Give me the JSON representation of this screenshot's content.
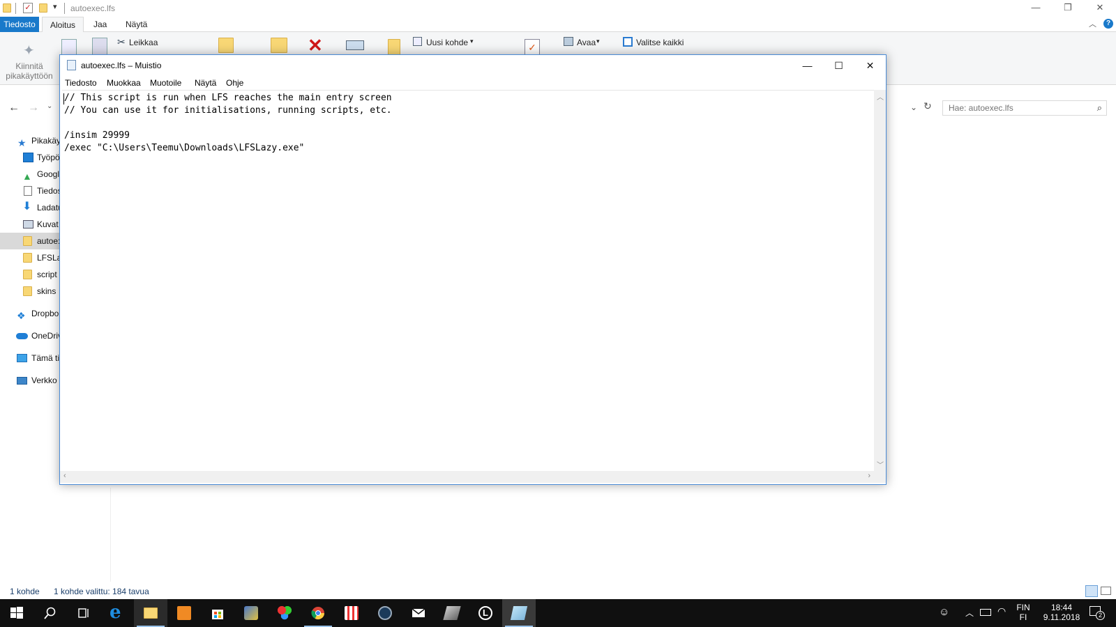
{
  "explorer": {
    "title": "autoexec.lfs",
    "tabs": [
      "Tiedosto",
      "Aloitus",
      "Jaa",
      "Näytä"
    ],
    "ribbon": {
      "pin_label_1": "Kiinnitä",
      "pin_label_2": "pikakäyttöön",
      "cut": "Leikkaa",
      "new_item": "Uusi kohde",
      "open": "Avaa",
      "select_all": "Valitse kaikki"
    },
    "search_placeholder": "Hae: autoexec.lfs",
    "nav": [
      {
        "label": "Pikakäy",
        "icon": "star-icon"
      },
      {
        "label": "Työpö",
        "icon": "desktop-icon"
      },
      {
        "label": "Googl",
        "icon": "google-drive-icon"
      },
      {
        "label": "Tiedos",
        "icon": "document-icon"
      },
      {
        "label": "Ladatu",
        "icon": "download-icon"
      },
      {
        "label": "Kuvat",
        "icon": "pictures-icon"
      },
      {
        "label": "autoe:",
        "icon": "folder-icon"
      },
      {
        "label": "LFSLaz",
        "icon": "folder-icon"
      },
      {
        "label": "script",
        "icon": "folder-icon"
      },
      {
        "label": "skins",
        "icon": "folder-icon"
      },
      {
        "label": "Dropbo",
        "icon": "dropbox-icon"
      },
      {
        "label": "OneDriv",
        "icon": "onedrive-icon"
      },
      {
        "label": "Tämä ti",
        "icon": "computer-icon"
      },
      {
        "label": "Verkko",
        "icon": "network-icon"
      }
    ],
    "status": {
      "count": "1 kohde",
      "selection": "1 kohde valittu: 184 tavua"
    }
  },
  "notepad": {
    "title": "autoexec.lfs – Muistio",
    "menu": [
      "Tiedosto",
      "Muokkaa",
      "Muotoile",
      "Näytä",
      "Ohje"
    ],
    "lines": [
      "// This script is run when LFS reaches the main entry screen",
      "// You can use it for initialisations, running scripts, etc.",
      "",
      "/insim 29999",
      "/exec \"C:\\Users\\Teemu\\Downloads\\LFSLazy.exe\""
    ]
  },
  "taskbar": {
    "lang_1": "FIN",
    "lang_2": "FI",
    "time": "18:44",
    "date": "9.11.2018",
    "notifications": "2"
  },
  "colors": {
    "accent": "#1979ca",
    "taskbar": "#101010",
    "folder": "#f8d775",
    "nav_selected": "#d9d9d9"
  }
}
